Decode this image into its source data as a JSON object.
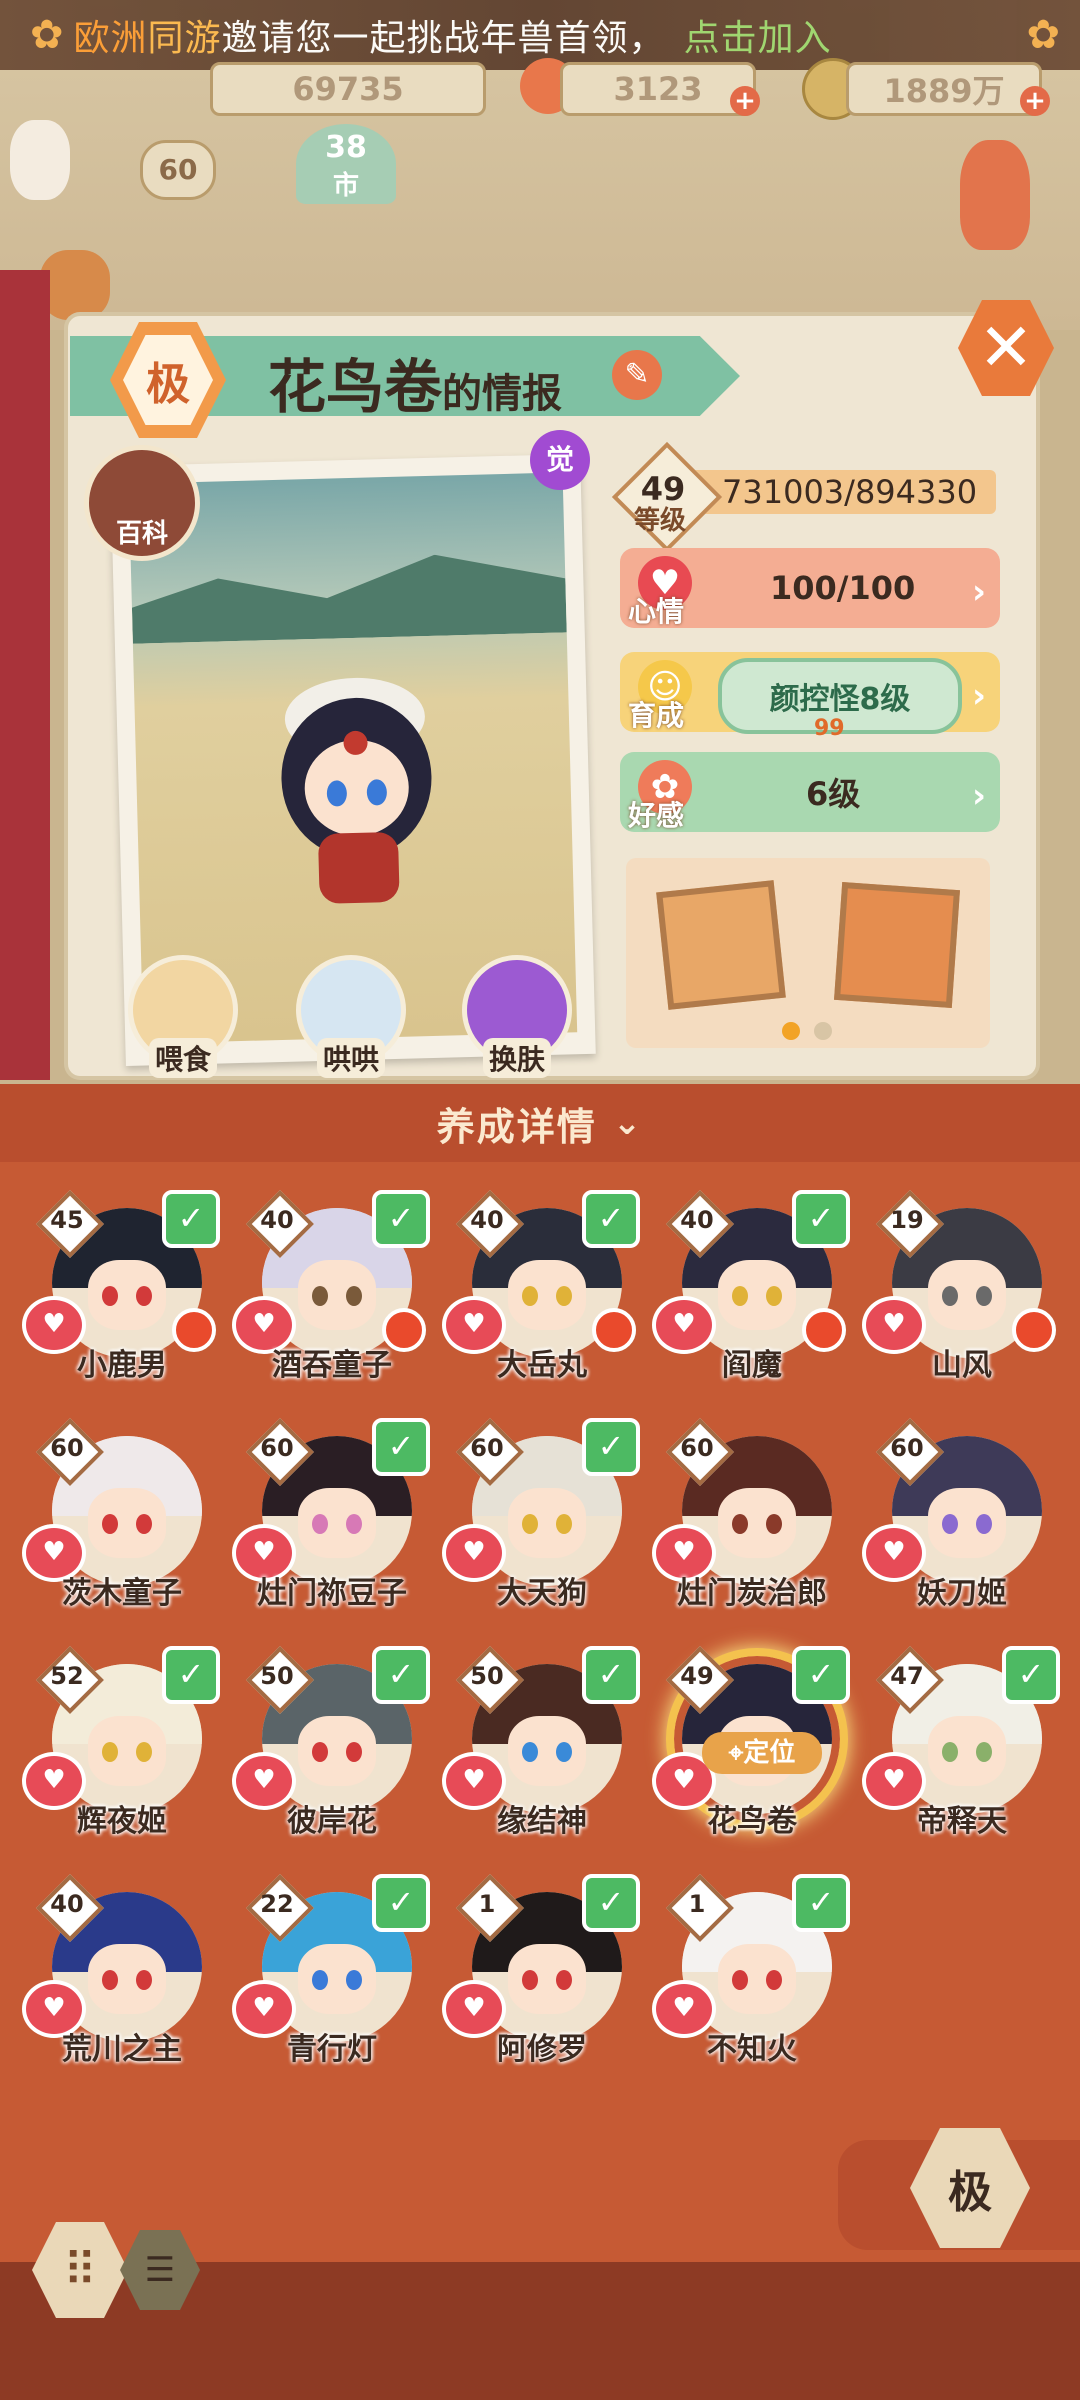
{
  "banner": {
    "server": "欧洲",
    "tongyou": "同游",
    "invite_text": "邀请您一起挑战年兽首领，",
    "join": "点击加入"
  },
  "resources": {
    "coins": "69735",
    "gem": "3123",
    "money": "1889万",
    "player_level": "60",
    "stage_badge": "38",
    "stage_sub": "市"
  },
  "shikigami": {
    "grade": "极",
    "name": "花鸟卷",
    "name_suffix": "的情报",
    "awaken": "觉",
    "baike": "百科",
    "level": "49",
    "level_label": "等级",
    "exp": "731003/894330",
    "mood_label": "心情",
    "mood": "100/100",
    "growth_label": "育成",
    "growth": "颜控怪8级",
    "growth_sub": "99",
    "favor_label": "好感",
    "favor": "6级",
    "actions": [
      "喂食",
      "哄哄",
      "换肤"
    ]
  },
  "panel": {
    "title": "养成详情",
    "locate": "定位",
    "grade_button": "极"
  },
  "roster": [
    {
      "name": "小鹿男",
      "level": "45",
      "check": true,
      "reddot": true,
      "hair": "#1f2430",
      "eye": "#d23a3a"
    },
    {
      "name": "酒吞童子",
      "level": "40",
      "check": true,
      "reddot": true,
      "hair": "#d9d5e8",
      "eye": "#7a5a3a"
    },
    {
      "name": "大岳丸",
      "level": "40",
      "check": true,
      "reddot": true,
      "hair": "#2a2d3a",
      "eye": "#e0b238"
    },
    {
      "name": "阎魔",
      "level": "40",
      "check": true,
      "reddot": true,
      "hair": "#2b2a3e",
      "eye": "#e0b238"
    },
    {
      "name": "山风",
      "level": "19",
      "check": false,
      "reddot": true,
      "hair": "#3b3b44",
      "eye": "#6a6a6a"
    },
    {
      "name": "茨木童子",
      "level": "60",
      "check": false,
      "reddot": false,
      "hair": "#efe9ea",
      "eye": "#d23a3a"
    },
    {
      "name": "灶门祢豆子",
      "level": "60",
      "check": true,
      "reddot": false,
      "hair": "#2a1e24",
      "eye": "#d779b6"
    },
    {
      "name": "大天狗",
      "level": "60",
      "check": true,
      "reddot": false,
      "hair": "#e6e1d6",
      "eye": "#e0b238"
    },
    {
      "name": "灶门炭治郎",
      "level": "60",
      "check": false,
      "reddot": false,
      "hair": "#5a2a22",
      "eye": "#8a3a2a"
    },
    {
      "name": "妖刀姬",
      "level": "60",
      "check": false,
      "reddot": false,
      "hair": "#3e3a58",
      "eye": "#8a6ad0"
    },
    {
      "name": "辉夜姬",
      "level": "52",
      "check": true,
      "reddot": false,
      "hair": "#f3ecd9",
      "eye": "#e0b238"
    },
    {
      "name": "彼岸花",
      "level": "50",
      "check": true,
      "reddot": false,
      "hair": "#5a6468",
      "eye": "#d23a3a"
    },
    {
      "name": "缘结神",
      "level": "50",
      "check": true,
      "reddot": false,
      "hair": "#4a2a22",
      "eye": "#3a8ad8"
    },
    {
      "name": "花鸟卷",
      "level": "49",
      "check": true,
      "reddot": false,
      "hair": "#26253a",
      "eye": "#3a7ad8"
    },
    {
      "name": "帝释天",
      "level": "47",
      "check": true,
      "reddot": false,
      "hair": "#f1efe6",
      "eye": "#8ab06a"
    },
    {
      "name": "荒川之主",
      "level": "40",
      "check": false,
      "reddot": false,
      "hair": "#2a3a8a",
      "eye": "#d23a3a"
    },
    {
      "name": "青行灯",
      "level": "22",
      "check": true,
      "reddot": false,
      "hair": "#3aa3d8",
      "eye": "#3a7ad8"
    },
    {
      "name": "阿修罗",
      "level": "1",
      "check": true,
      "reddot": false,
      "hair": "#1f1a1a",
      "eye": "#d23a3a"
    },
    {
      "name": "不知火",
      "level": "1",
      "check": true,
      "reddot": false,
      "hair": "#f4f2f0",
      "eye": "#d23a3a"
    }
  ]
}
